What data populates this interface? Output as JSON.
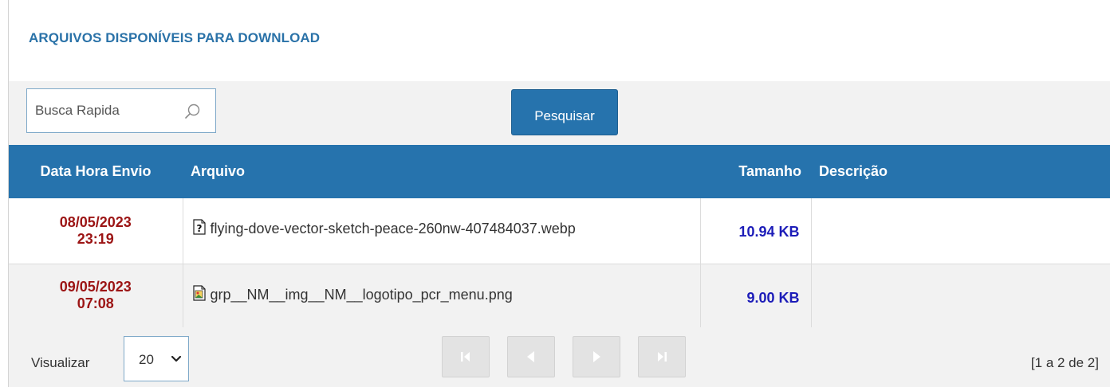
{
  "page": {
    "title": "ARQUIVOS DISPONÍVEIS PARA DOWNLOAD"
  },
  "toolbar": {
    "search_placeholder": "Busca Rapida",
    "search_value": "",
    "search_button_label": "Pesquisar"
  },
  "table": {
    "columns": [
      "Data Hora Envio",
      "Arquivo",
      "Tamanho",
      "Descrição"
    ],
    "rows": [
      {
        "date": "08/05/2023",
        "time": "23:19",
        "file_icon": "unknown-file-icon",
        "file": "flying-dove-vector-sketch-peace-260nw-407484037.webp",
        "size": "10.94 KB",
        "description": ""
      },
      {
        "date": "09/05/2023",
        "time": "07:08",
        "file_icon": "image-file-icon",
        "file": "grp__NM__img__NM__logotipo_pcr_menu.png",
        "size": "9.00 KB",
        "description": ""
      }
    ]
  },
  "footer": {
    "view_label": "Visualizar",
    "page_size": "20",
    "record_range": "[1 a 2 de 2]"
  },
  "colors": {
    "header_blue": "#2673ad",
    "title_blue": "#2a72a8",
    "date_red": "#9c1515",
    "size_blue": "#1c1cb8"
  }
}
